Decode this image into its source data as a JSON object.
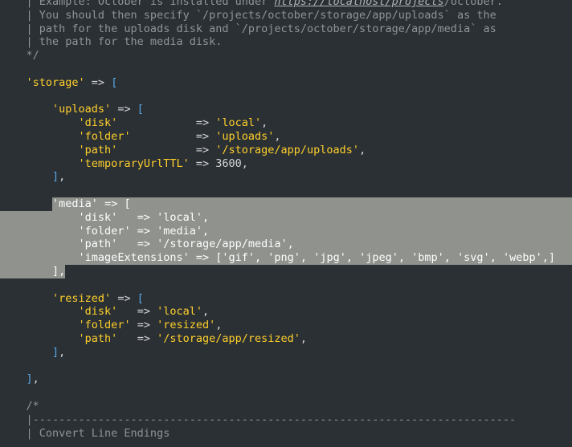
{
  "editor": {
    "lines": [
      {
        "segments": [
          {
            "t": "    | Example: October is installed under ",
            "c": "comment"
          },
          {
            "t": "https://localhost/projects",
            "c": "url"
          },
          {
            "t": "/october.",
            "c": "comment"
          }
        ]
      },
      {
        "segments": [
          {
            "t": "    | You should then specify `/projects/october/storage/app/uploads` as the",
            "c": "comment"
          }
        ]
      },
      {
        "segments": [
          {
            "t": "    | path for the uploads disk and `/projects/october/storage/app/media` as",
            "c": "comment"
          }
        ]
      },
      {
        "segments": [
          {
            "t": "    | the path for the media disk.",
            "c": "comment"
          }
        ]
      },
      {
        "segments": [
          {
            "t": "    */",
            "c": "comment"
          }
        ]
      },
      {
        "segments": []
      },
      {
        "segments": [
          {
            "t": "    ",
            "c": "plain"
          },
          {
            "t": "'storage'",
            "c": "key"
          },
          {
            "t": " => ",
            "c": "op"
          },
          {
            "t": "[",
            "c": "bracket"
          }
        ]
      },
      {
        "segments": []
      },
      {
        "segments": [
          {
            "t": "        ",
            "c": "plain"
          },
          {
            "t": "'uploads'",
            "c": "key"
          },
          {
            "t": " => ",
            "c": "op"
          },
          {
            "t": "[",
            "c": "bracket"
          }
        ]
      },
      {
        "segments": [
          {
            "t": "            ",
            "c": "plain"
          },
          {
            "t": "'disk'",
            "c": "key"
          },
          {
            "t": "            => ",
            "c": "op"
          },
          {
            "t": "'local'",
            "c": "str"
          },
          {
            "t": ",",
            "c": "op"
          }
        ]
      },
      {
        "segments": [
          {
            "t": "            ",
            "c": "plain"
          },
          {
            "t": "'folder'",
            "c": "key"
          },
          {
            "t": "          => ",
            "c": "op"
          },
          {
            "t": "'uploads'",
            "c": "str"
          },
          {
            "t": ",",
            "c": "op"
          }
        ]
      },
      {
        "segments": [
          {
            "t": "            ",
            "c": "plain"
          },
          {
            "t": "'path'",
            "c": "key"
          },
          {
            "t": "            => ",
            "c": "op"
          },
          {
            "t": "'/storage/app/uploads'",
            "c": "str"
          },
          {
            "t": ",",
            "c": "op"
          }
        ]
      },
      {
        "segments": [
          {
            "t": "            ",
            "c": "plain"
          },
          {
            "t": "'temporaryUrlTTL'",
            "c": "key"
          },
          {
            "t": " => ",
            "c": "op"
          },
          {
            "t": "3600",
            "c": "num"
          },
          {
            "t": ",",
            "c": "op"
          }
        ]
      },
      {
        "segments": [
          {
            "t": "        ",
            "c": "plain"
          },
          {
            "t": "]",
            "c": "bracket"
          },
          {
            "t": ",",
            "c": "op"
          }
        ]
      },
      {
        "segments": []
      },
      {
        "selected": true,
        "segments": [
          {
            "t": "        ",
            "c": "plain"
          },
          {
            "t": "'media'",
            "c": "key"
          },
          {
            "t": " => ",
            "c": "op"
          },
          {
            "t": "[",
            "c": "bracket"
          }
        ]
      },
      {
        "selected": true,
        "segments": [
          {
            "t": "            ",
            "c": "plain"
          },
          {
            "t": "'disk'",
            "c": "key"
          },
          {
            "t": "   => ",
            "c": "op"
          },
          {
            "t": "'local'",
            "c": "str"
          },
          {
            "t": ",",
            "c": "op"
          }
        ]
      },
      {
        "selected": true,
        "segments": [
          {
            "t": "            ",
            "c": "plain"
          },
          {
            "t": "'folder'",
            "c": "key"
          },
          {
            "t": " => ",
            "c": "op"
          },
          {
            "t": "'media'",
            "c": "str"
          },
          {
            "t": ",",
            "c": "op"
          }
        ]
      },
      {
        "selected": true,
        "segments": [
          {
            "t": "            ",
            "c": "plain"
          },
          {
            "t": "'path'",
            "c": "key"
          },
          {
            "t": "   => ",
            "c": "op"
          },
          {
            "t": "'/storage/app/media'",
            "c": "str"
          },
          {
            "t": ",",
            "c": "op"
          }
        ]
      },
      {
        "selected": true,
        "segments": [
          {
            "t": "            ",
            "c": "plain"
          },
          {
            "t": "'imageExtensions'",
            "c": "key"
          },
          {
            "t": " => ",
            "c": "op"
          },
          {
            "t": "[",
            "c": "bracket"
          },
          {
            "t": "'gif'",
            "c": "str"
          },
          {
            "t": ", ",
            "c": "op"
          },
          {
            "t": "'png'",
            "c": "str"
          },
          {
            "t": ", ",
            "c": "op"
          },
          {
            "t": "'jpg'",
            "c": "str"
          },
          {
            "t": ", ",
            "c": "op"
          },
          {
            "t": "'jpeg'",
            "c": "str"
          },
          {
            "t": ", ",
            "c": "op"
          },
          {
            "t": "'bmp'",
            "c": "str"
          },
          {
            "t": ", ",
            "c": "op"
          },
          {
            "t": "'svg'",
            "c": "str"
          },
          {
            "t": ", ",
            "c": "op"
          },
          {
            "t": "'webp'",
            "c": "str"
          },
          {
            "t": ",",
            "c": "op"
          },
          {
            "t": "]",
            "c": "bracket"
          }
        ]
      },
      {
        "selected": true,
        "segments": [
          {
            "t": "        ",
            "c": "plain"
          },
          {
            "t": "]",
            "c": "bracket"
          },
          {
            "t": ",",
            "c": "op"
          }
        ]
      },
      {
        "segments": []
      },
      {
        "segments": [
          {
            "t": "        ",
            "c": "plain"
          },
          {
            "t": "'resized'",
            "c": "key"
          },
          {
            "t": " => ",
            "c": "op"
          },
          {
            "t": "[",
            "c": "bracket"
          }
        ]
      },
      {
        "segments": [
          {
            "t": "            ",
            "c": "plain"
          },
          {
            "t": "'disk'",
            "c": "key"
          },
          {
            "t": "   => ",
            "c": "op"
          },
          {
            "t": "'local'",
            "c": "str"
          },
          {
            "t": ",",
            "c": "op"
          }
        ]
      },
      {
        "segments": [
          {
            "t": "            ",
            "c": "plain"
          },
          {
            "t": "'folder'",
            "c": "key"
          },
          {
            "t": " => ",
            "c": "op"
          },
          {
            "t": "'resized'",
            "c": "str"
          },
          {
            "t": ",",
            "c": "op"
          }
        ]
      },
      {
        "segments": [
          {
            "t": "            ",
            "c": "plain"
          },
          {
            "t": "'path'",
            "c": "key"
          },
          {
            "t": "   => ",
            "c": "op"
          },
          {
            "t": "'/storage/app/resized'",
            "c": "str"
          },
          {
            "t": ",",
            "c": "op"
          }
        ]
      },
      {
        "segments": [
          {
            "t": "        ",
            "c": "plain"
          },
          {
            "t": "]",
            "c": "bracket"
          },
          {
            "t": ",",
            "c": "op"
          }
        ]
      },
      {
        "segments": []
      },
      {
        "segments": [
          {
            "t": "    ",
            "c": "plain"
          },
          {
            "t": "]",
            "c": "bracket"
          },
          {
            "t": ",",
            "c": "op"
          }
        ]
      },
      {
        "segments": []
      },
      {
        "segments": [
          {
            "t": "    /*",
            "c": "comment"
          }
        ]
      },
      {
        "segments": [
          {
            "t": "    |--------------------------------------------------------------------------",
            "c": "comment"
          }
        ]
      },
      {
        "segments": [
          {
            "t": "    | Convert Line Endings",
            "c": "comment"
          }
        ]
      }
    ]
  },
  "colors": {
    "background": "#2b3035",
    "selection": "#8f928d",
    "comment": "#8f9499",
    "string": "#ffd02a",
    "bracket": "#5aa9e6",
    "text": "#d6d6d6"
  }
}
